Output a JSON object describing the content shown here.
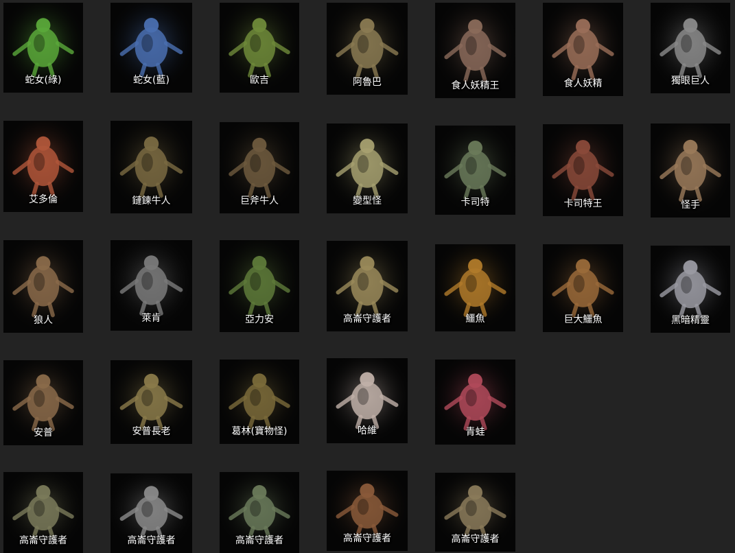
{
  "monsters": [
    {
      "name": "蛇女(綠)",
      "color": "#5aa83a"
    },
    {
      "name": "蛇女(藍)",
      "color": "#4a6fb0"
    },
    {
      "name": "歐吉",
      "color": "#6f8a3a"
    },
    {
      "name": "阿魯巴",
      "color": "#8a7a52"
    },
    {
      "name": "食人妖精王",
      "color": "#8a6a5a"
    },
    {
      "name": "食人妖精",
      "color": "#9a6e58"
    },
    {
      "name": "獨眼巨人",
      "color": "#8a8a8a"
    },
    {
      "name": "艾多倫",
      "color": "#b0563a"
    },
    {
      "name": "鏈鍊牛人",
      "color": "#7a6a42"
    },
    {
      "name": "巨斧牛人",
      "color": "#6e5a3e"
    },
    {
      "name": "變型怪",
      "color": "#a6a070"
    },
    {
      "name": "卡司特",
      "color": "#6a7a5a"
    },
    {
      "name": "卡司特王",
      "color": "#8a4a3a"
    },
    {
      "name": "怪手",
      "color": "#9a7a5a"
    },
    {
      "name": "狼人",
      "color": "#8a6a4a"
    },
    {
      "name": "萊肯",
      "color": "#7a7a7a"
    },
    {
      "name": "亞力安",
      "color": "#5e7a3a"
    },
    {
      "name": "高崙守護者",
      "color": "#9a8a5a"
    },
    {
      "name": "鱷魚",
      "color": "#b07a2a"
    },
    {
      "name": "巨大鱷魚",
      "color": "#9a6a3a"
    },
    {
      "name": "黑暗精靈",
      "color": "#9a9aa2"
    },
    {
      "name": "安普",
      "color": "#8a6a4a"
    },
    {
      "name": "安普長老",
      "color": "#8a7a4a"
    },
    {
      "name": "葛林(寶物怪)",
      "color": "#7a6a3a"
    },
    {
      "name": "哈維",
      "color": "#c0b0a8"
    },
    {
      "name": "青蛙",
      "color": "#b04a5a"
    },
    {
      "name": "高崙守護者",
      "color": "#7a7a5a"
    },
    {
      "name": "高崙守護者",
      "color": "#8a8a8a"
    },
    {
      "name": "高崙守護者",
      "color": "#6a7a5a"
    },
    {
      "name": "高崙守護者",
      "color": "#8a5a3a"
    },
    {
      "name": "高崙守護者",
      "color": "#8a7a5a"
    }
  ]
}
